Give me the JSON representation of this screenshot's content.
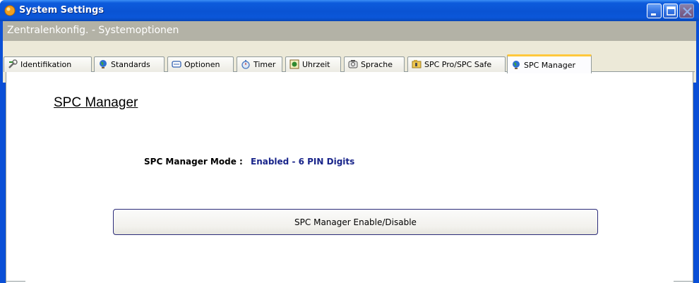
{
  "window": {
    "title": "System Settings",
    "buttons": [
      "minimize",
      "maximize",
      "close"
    ]
  },
  "header": {
    "breadcrumb": "Zentralenkonfig. - Systemoptionen"
  },
  "tabs": [
    {
      "label": "Identifikation",
      "icon": "wrench-icon",
      "active": false
    },
    {
      "label": "Standards",
      "icon": "globe-icon",
      "active": false
    },
    {
      "label": "Optionen",
      "icon": "options-icon",
      "active": false
    },
    {
      "label": "Timer",
      "icon": "timer-icon",
      "active": false
    },
    {
      "label": "Uhrzeit",
      "icon": "clock-icon",
      "active": false
    },
    {
      "label": "Sprache",
      "icon": "language-icon",
      "active": false
    },
    {
      "label": "SPC Pro/SPC Safe",
      "icon": "folder-icon",
      "active": false
    },
    {
      "label": "SPC Manager",
      "icon": "globe-icon",
      "active": true
    }
  ],
  "content": {
    "section_title": "SPC Manager",
    "mode_label": "SPC Manager Mode :",
    "mode_value": "Enabled - 6 PIN Digits",
    "action_button": "SPC Manager Enable/Disable"
  },
  "colors": {
    "titlebar": "#0a53d3",
    "header_band": "#b3b2a6",
    "tab_strip": "#ece9d8",
    "active_tab_accent": "#ffc83c",
    "mode_value": "#18248a"
  }
}
